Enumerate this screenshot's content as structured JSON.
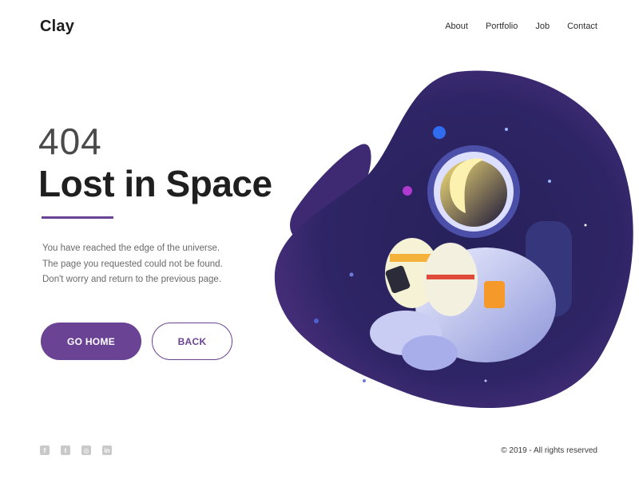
{
  "brand": {
    "logo": "Clay"
  },
  "nav": {
    "items": [
      "About",
      "Portfolio",
      "Job",
      "Contact"
    ]
  },
  "hero": {
    "code": "404",
    "headline": "Lost in Space",
    "description": [
      "You have reached the edge of the universe.",
      "The page you requested could not be found.",
      "Don't worry and return to the previous page."
    ]
  },
  "buttons": {
    "home_label": "GO HOME",
    "back_label": "BACK"
  },
  "footer": {
    "socials": [
      {
        "icon": "facebook-icon",
        "glyph": "f"
      },
      {
        "icon": "twitter-icon",
        "glyph": "t"
      },
      {
        "icon": "instagram-icon",
        "glyph": "◎"
      },
      {
        "icon": "linkedin-icon",
        "glyph": "in"
      }
    ],
    "copyright": "© 2019 - All rights reserved"
  },
  "colors": {
    "accent": "#6b4394",
    "space": "#3a2a6e",
    "text": "#1f1f1f"
  }
}
